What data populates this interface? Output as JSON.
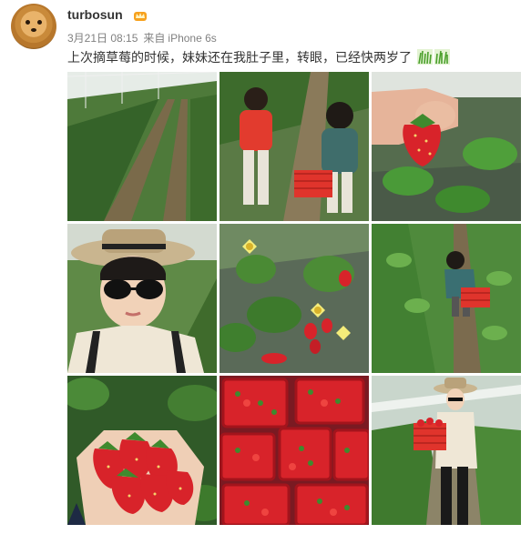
{
  "post": {
    "username": "turbosun",
    "date": "3月21日 08:15",
    "source_prefix": "来自",
    "source_device": "iPhone 6s",
    "text": "上次摘草莓的时候，妹妹还在我肚子里，转眼，已经快两岁了"
  },
  "icons": {
    "avatar": "pomeranian-avatar",
    "badge": "vip-crown-icon",
    "emoji": "grass-emoji-icon"
  },
  "colors": {
    "username": "#333333",
    "meta": "#808080",
    "text": "#333333",
    "strawberry": "#d8232a",
    "leaf": "#3f8a2e"
  },
  "photos": [
    {
      "subject": "greenhouse-rows"
    },
    {
      "subject": "kids-picking"
    },
    {
      "subject": "hand-holding-strawberry"
    },
    {
      "subject": "selfie-with-hat"
    },
    {
      "subject": "strawberry-plant-flowers"
    },
    {
      "subject": "child-in-row"
    },
    {
      "subject": "handful-of-strawberries"
    },
    {
      "subject": "baskets-of-strawberries"
    },
    {
      "subject": "woman-with-basket"
    }
  ]
}
